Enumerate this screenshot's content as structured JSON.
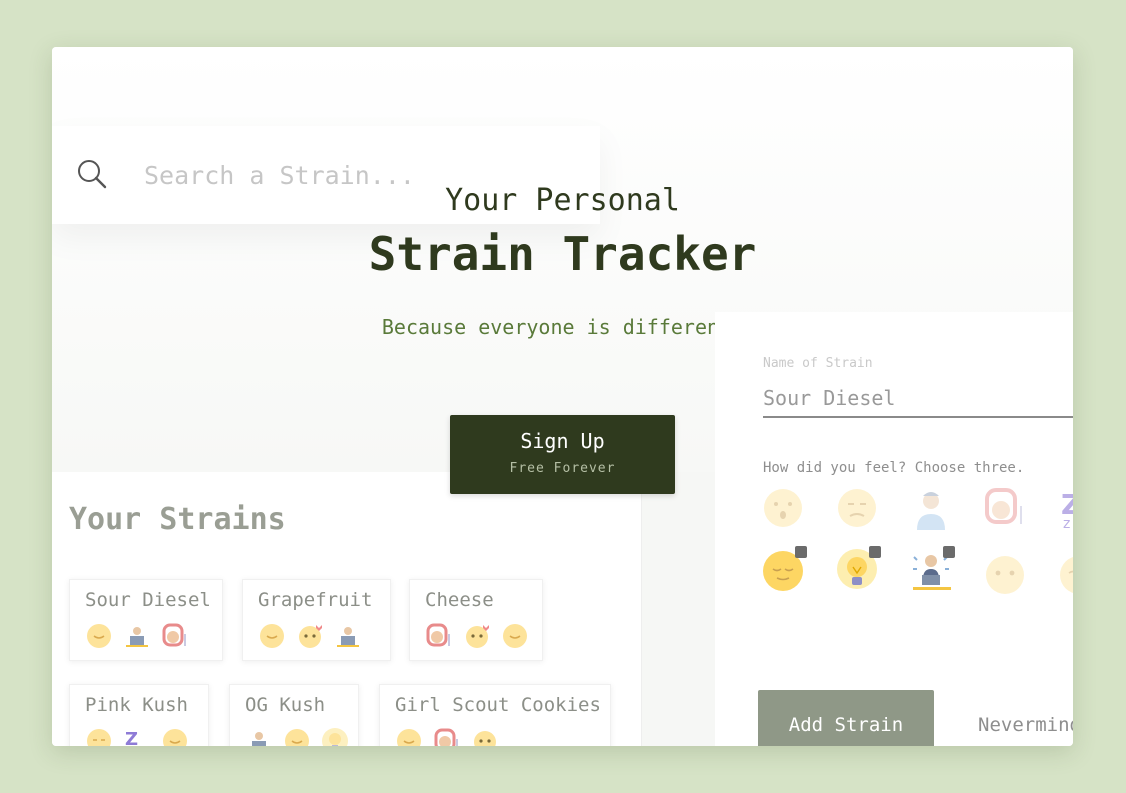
{
  "search": {
    "placeholder": "Search a Strain..."
  },
  "hero": {
    "line1": "Your Personal",
    "line2": "Strain Tracker",
    "subtitle": "Because everyone is different."
  },
  "signup": {
    "label": "Sign Up",
    "sublabel": "Free Forever"
  },
  "strains": {
    "title": "Your Strains",
    "cards": [
      {
        "name": "Sour Diesel",
        "icons": [
          "smile-icon",
          "focused-worker-icon",
          "aroused-icon"
        ]
      },
      {
        "name": "Grapefruit",
        "icons": [
          "smile-icon",
          "heart-eyes-icon",
          "focused-worker-icon"
        ]
      },
      {
        "name": "Cheese",
        "icons": [
          "aroused-icon",
          "heart-eyes-icon",
          "smile-icon"
        ]
      },
      {
        "name": "Pink Kush",
        "icons": [
          "sleepy-face-icon",
          "sleep-zz-icon",
          "smile-icon"
        ]
      },
      {
        "name": "OG Kush",
        "icons": [
          "focused-worker-icon",
          "smile-icon",
          "creative-bulb-icon"
        ]
      },
      {
        "name": "Girl Scout Cookies",
        "icons": [
          "smile-icon",
          "aroused-icon",
          "heart-eyes-icon"
        ]
      }
    ]
  },
  "form": {
    "name_label": "Name of Strain",
    "name_value": "Sour Diesel",
    "feel_label": "How did you feel? Choose three.",
    "emotions": [
      {
        "icon": "surprised-face-icon",
        "selected": false
      },
      {
        "icon": "confused-face-icon",
        "selected": false
      },
      {
        "icon": "dizzy-person-icon",
        "selected": false
      },
      {
        "icon": "aroused-icon",
        "selected": false
      },
      {
        "icon": "sleep-zz-icon",
        "selected": false
      },
      {
        "icon": "relaxed-face-icon",
        "selected": true
      },
      {
        "icon": "creative-bulb-icon",
        "selected": true
      },
      {
        "icon": "focused-worker-icon",
        "selected": true
      },
      {
        "icon": "happy-face-icon",
        "selected": false
      },
      {
        "icon": "smile-face-icon",
        "selected": false
      }
    ],
    "add_label": "Add Strain",
    "cancel_label": "Nevermind"
  },
  "colors": {
    "background": "#d6e3c6",
    "dark_green": "#2f3a1e",
    "text_green": "#5a7a3a",
    "button_gray": "#8f9887",
    "emoji_yellow": "#fdd663"
  }
}
